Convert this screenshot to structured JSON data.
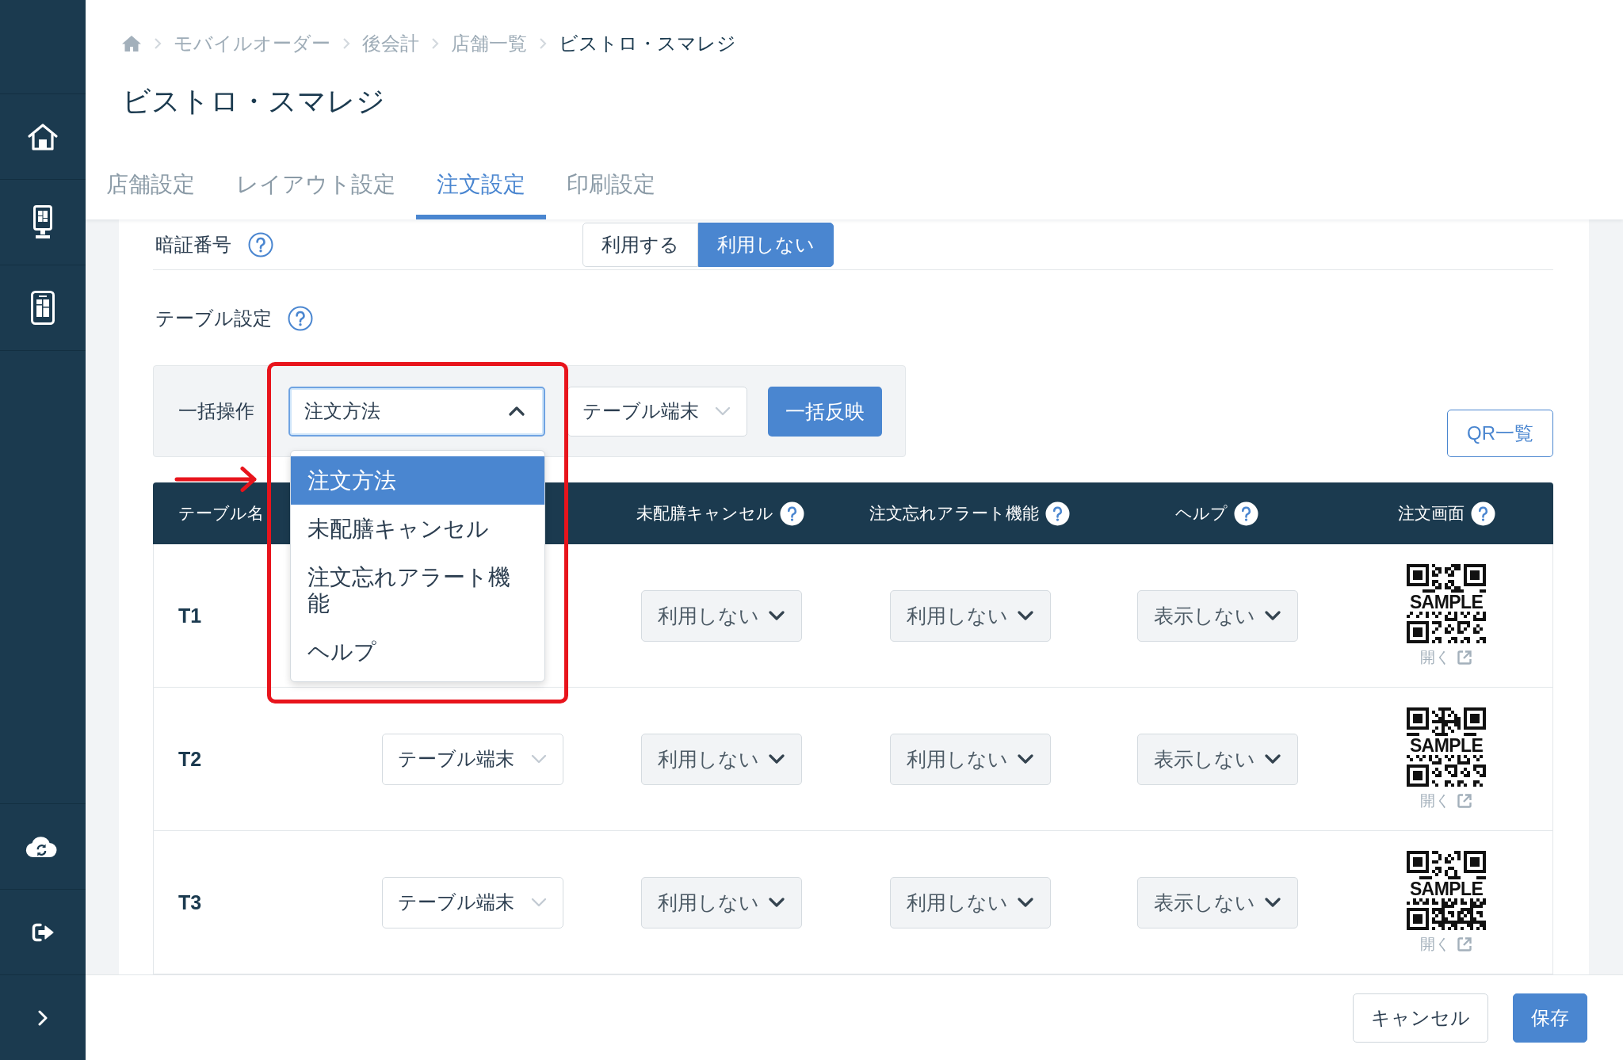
{
  "breadcrumb": [
    {
      "label": "モバイルオーダー",
      "current": false
    },
    {
      "label": "後会計",
      "current": false
    },
    {
      "label": "店舗一覧",
      "current": false
    },
    {
      "label": "ビストロ・スマレジ",
      "current": true
    }
  ],
  "page_title": "ビストロ・スマレジ",
  "tabs": [
    {
      "label": "店舗設定",
      "selected": false
    },
    {
      "label": "レイアウト設定",
      "selected": false
    },
    {
      "label": "注文設定",
      "selected": true
    },
    {
      "label": "印刷設定",
      "selected": false
    }
  ],
  "pin_code": {
    "label": "暗証番号",
    "options": [
      {
        "label": "利用する",
        "selected": false
      },
      {
        "label": "利用しない",
        "selected": true
      }
    ]
  },
  "table_settings": {
    "label": "テーブル設定",
    "bulk_operation": {
      "label": "一括操作",
      "target_select": {
        "value": "注文方法",
        "expanded": true,
        "options": [
          {
            "label": "注文方法",
            "selected": true
          },
          {
            "label": "未配膳キャンセル",
            "selected": false
          },
          {
            "label": "注文忘れアラート機能",
            "selected": false
          },
          {
            "label": "ヘルプ",
            "selected": false
          }
        ]
      },
      "value_select": {
        "value": "テーブル端末",
        "expanded": false
      },
      "apply_button": "一括反映"
    },
    "qr_list_button": "QR一覧",
    "columns": [
      {
        "kind": "text",
        "label": "テーブル名",
        "help": false
      },
      {
        "kind": "covered"
      },
      {
        "kind": "text",
        "label": "未配膳キャンセル",
        "help": true
      },
      {
        "kind": "text",
        "label": "注文忘れアラート機能",
        "help": true
      },
      {
        "kind": "text",
        "label": "ヘルプ",
        "help": true
      },
      {
        "kind": "text",
        "label": "注文画面",
        "help": true
      }
    ],
    "rows": [
      {
        "cells": [
          {
            "kind": "name",
            "value": "T1"
          },
          {
            "kind": "covered"
          },
          {
            "kind": "dropdown",
            "value": "利用しない"
          },
          {
            "kind": "dropdown",
            "value": "利用しない"
          },
          {
            "kind": "dropdown",
            "value": "表示しない"
          },
          {
            "kind": "qr",
            "sample_label": "SAMPLE",
            "link": "開く"
          }
        ]
      },
      {
        "cells": [
          {
            "kind": "name",
            "value": "T2"
          },
          {
            "kind": "select",
            "value": "テーブル端末"
          },
          {
            "kind": "dropdown",
            "value": "利用しない"
          },
          {
            "kind": "dropdown",
            "value": "利用しない"
          },
          {
            "kind": "dropdown",
            "value": "表示しない"
          },
          {
            "kind": "qr",
            "sample_label": "SAMPLE",
            "link": "開く"
          }
        ]
      },
      {
        "cells": [
          {
            "kind": "name",
            "value": "T3"
          },
          {
            "kind": "select",
            "value": "テーブル端末"
          },
          {
            "kind": "dropdown",
            "value": "利用しない"
          },
          {
            "kind": "dropdown",
            "value": "利用しない"
          },
          {
            "kind": "dropdown",
            "value": "表示しない"
          },
          {
            "kind": "qr",
            "sample_label": "SAMPLE",
            "link": "開く"
          }
        ]
      }
    ]
  },
  "footer": {
    "buttons": [
      {
        "label": "キャンセル",
        "kind": "secondary"
      },
      {
        "label": "保存",
        "kind": "primary"
      }
    ]
  }
}
